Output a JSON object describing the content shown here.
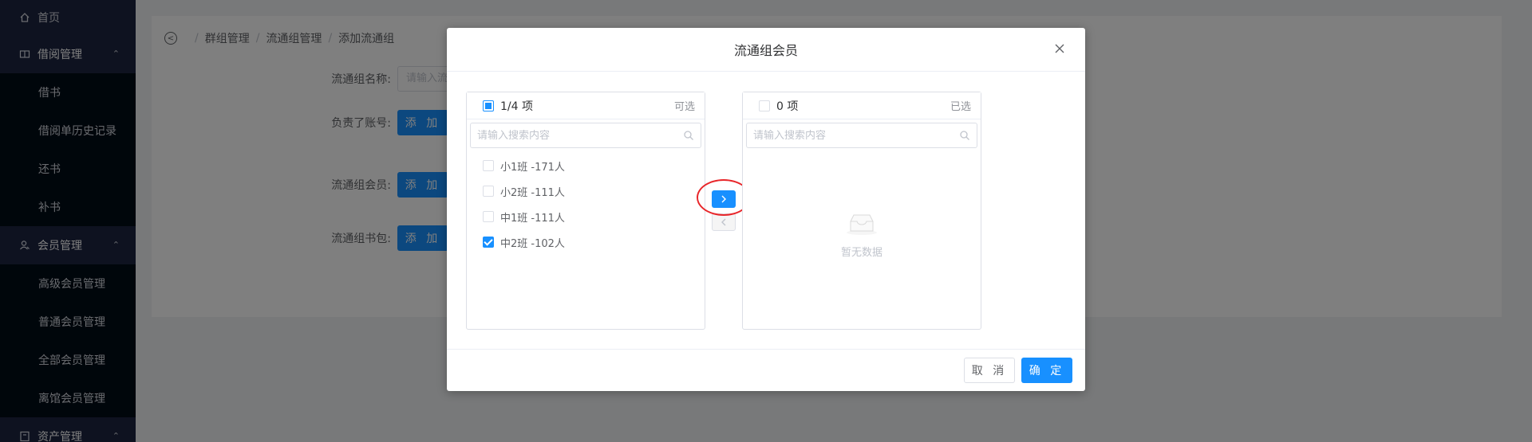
{
  "sidebar": {
    "home": "首页",
    "groups": [
      {
        "label": "借阅管理",
        "items": [
          "借书",
          "借阅单历史记录",
          "还书",
          "补书"
        ]
      },
      {
        "label": "会员管理",
        "items": [
          "高级会员管理",
          "普通会员管理",
          "全部会员管理",
          "离馆会员管理"
        ]
      },
      {
        "label": "资产管理",
        "items": []
      }
    ]
  },
  "breadcrumb": [
    "群组管理",
    "流通组管理",
    "添加流通组"
  ],
  "form": {
    "name_label": "流通组名称:",
    "name_placeholder": "请输入流",
    "account_label": "负责了账号:",
    "members_label": "流通组会员:",
    "books_label": "流通组书包:",
    "add_label": "添 加"
  },
  "dialog": {
    "title": "流通组会员",
    "cancel": "取 消",
    "ok": "确 定",
    "left": {
      "count": "1/4 项",
      "hint": "可选",
      "search_placeholder": "请输入搜索内容",
      "items": [
        {
          "label": "小1班 -171人",
          "checked": false
        },
        {
          "label": "小2班 -111人",
          "checked": false
        },
        {
          "label": "中1班 -111人",
          "checked": false
        },
        {
          "label": "中2班 -102人",
          "checked": true
        }
      ]
    },
    "right": {
      "count": "0 项",
      "hint": "已选",
      "search_placeholder": "请输入搜索内容",
      "empty": "暂无数据"
    }
  },
  "colors": {
    "primary": "#1890ff",
    "sidebar": "#001529",
    "highlight": "#e8262a"
  }
}
